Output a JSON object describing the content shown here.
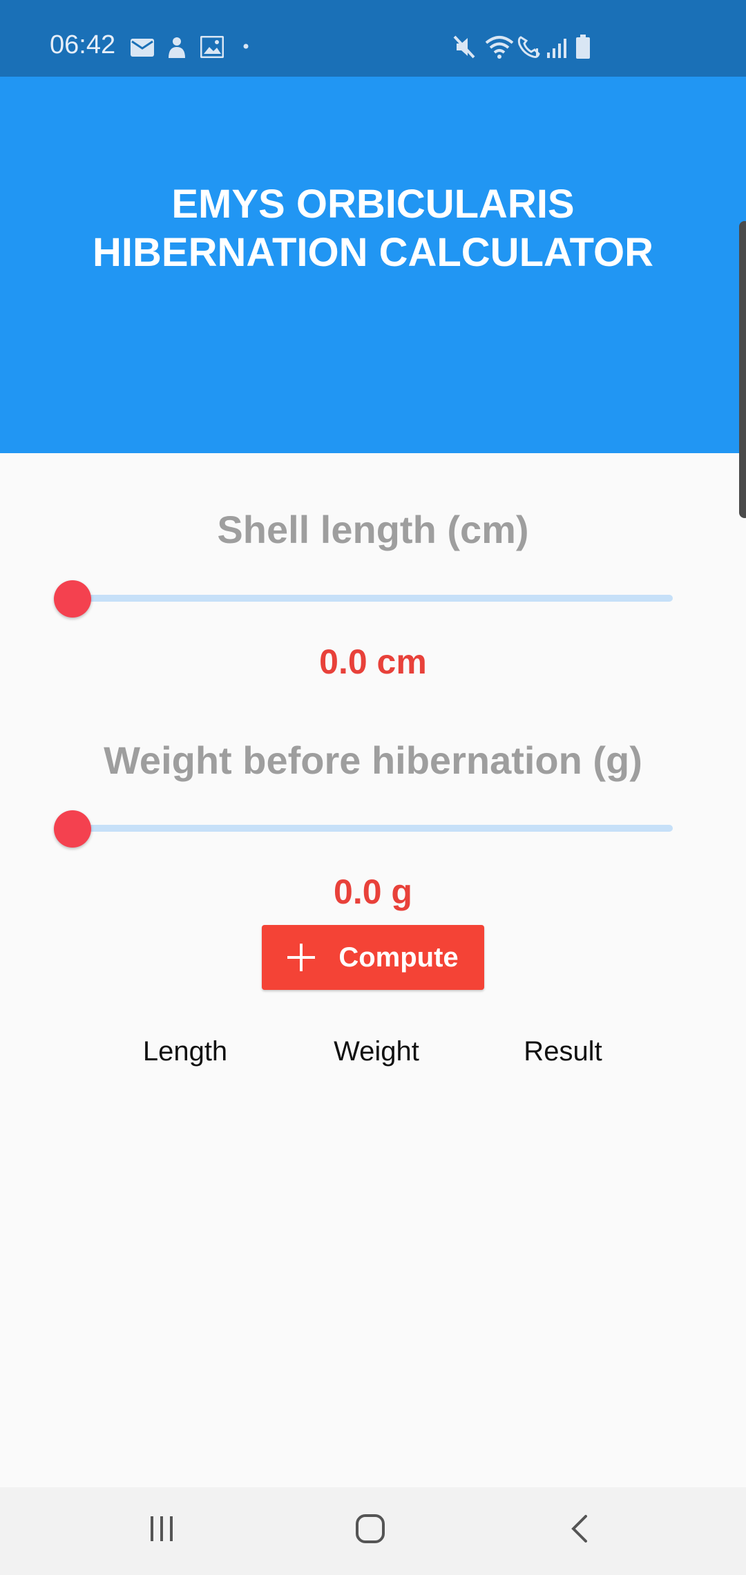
{
  "status_bar": {
    "time": "06:42",
    "left_icons": [
      "mail-icon",
      "notification-icon",
      "gallery-icon",
      "dot-icon"
    ],
    "right_icons": [
      "mute-icon",
      "wifi-icon",
      "wifi-call-icon",
      "signal-icon",
      "battery-icon"
    ]
  },
  "header": {
    "title": "EMYS ORBICULARIS\nHIBERNATION CALCULATOR",
    "background": "#2196f3"
  },
  "length_section": {
    "label": "Shell length (cm)",
    "value_text": "0.0 cm",
    "slider_value": 0.0
  },
  "weight_section": {
    "label": "Weight before hibernation (g)",
    "value_text": "0.0 g",
    "slider_value": 0.0
  },
  "compute_button": {
    "label": "Compute",
    "icon": "plus-icon",
    "color": "#f44336"
  },
  "results_table": {
    "columns": [
      "Length",
      "Weight",
      "Result"
    ],
    "rows": []
  },
  "nav_bar": {
    "buttons": [
      "recent-apps-icon",
      "home-icon",
      "back-icon"
    ]
  },
  "colors": {
    "accent": "#f4414f",
    "value_text": "#e8413a",
    "label_text": "#9e9e9e"
  }
}
